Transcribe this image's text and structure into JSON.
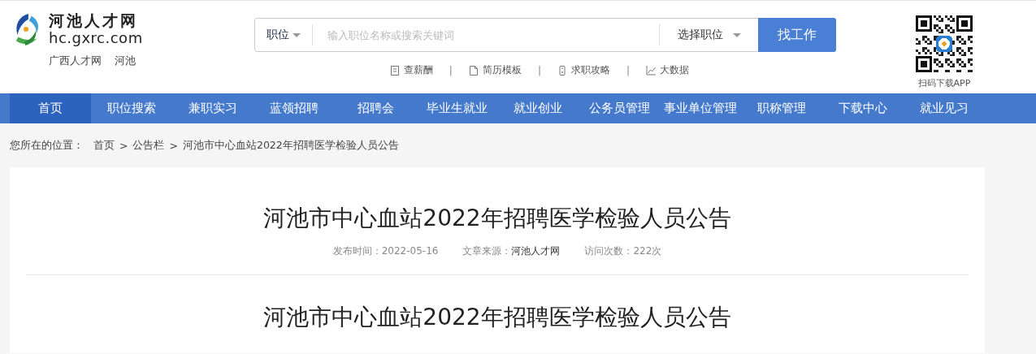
{
  "logo": {
    "title": "河池人才网",
    "domain": "hc.gxrc.com",
    "tags": [
      "广西人才网",
      "河池"
    ]
  },
  "search": {
    "category": "职位",
    "placeholder": "输入职位名称或搜索关键词",
    "position_select": "选择职位",
    "button": "找工作"
  },
  "quick_links": [
    {
      "label": "查薪酬",
      "kind": "receipt"
    },
    {
      "label": "简历模板",
      "kind": "document"
    },
    {
      "label": "求职攻略",
      "kind": "phone"
    },
    {
      "label": "大数据",
      "kind": "chart"
    }
  ],
  "separator": "|",
  "app_download": {
    "label": "扫码下载APP"
  },
  "nav": [
    {
      "label": "首页",
      "selected": true
    },
    {
      "label": "职位搜索",
      "selected": false
    },
    {
      "label": "兼职实习",
      "selected": false
    },
    {
      "label": "蓝领招聘",
      "selected": false
    },
    {
      "label": "招聘会",
      "selected": false
    },
    {
      "label": "毕业生就业",
      "selected": false
    },
    {
      "label": "就业创业",
      "selected": false
    },
    {
      "label": "公务员管理",
      "selected": false
    },
    {
      "label": "事业单位管理",
      "selected": false
    },
    {
      "label": "职称管理",
      "selected": false
    },
    {
      "label": "下载中心",
      "selected": false
    },
    {
      "label": "就业见习",
      "selected": false
    }
  ],
  "breadcrumb": {
    "label": "您所在的位置：",
    "separator": ">",
    "items": [
      {
        "label": "首页"
      },
      {
        "label": "公告栏"
      },
      {
        "label": "河池市中心血站2022年招聘医学检验人员公告"
      }
    ]
  },
  "article": {
    "title": "河池市中心血站2022年招聘医学检验人员公告",
    "meta": [
      {
        "label": "发布时间：",
        "value": "2022-05-16",
        "kind": "plain"
      },
      {
        "label": "文章来源：",
        "value": "河池人才网",
        "kind": "strong"
      },
      {
        "label": "访问次数：",
        "value": "222次",
        "kind": "plain"
      }
    ],
    "body_title": "河池市中心血站2022年招聘医学检验人员公告"
  }
}
